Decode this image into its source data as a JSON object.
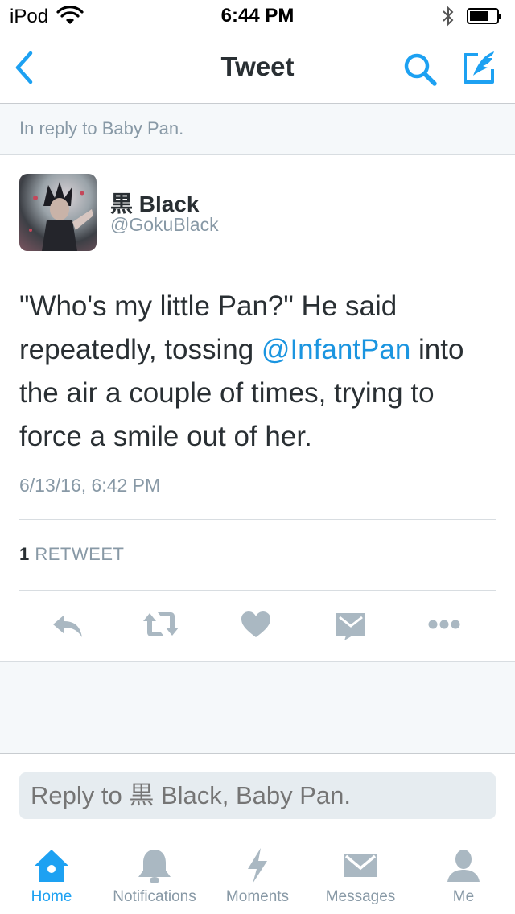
{
  "status_bar": {
    "carrier": "iPod",
    "time": "6:44 PM"
  },
  "nav": {
    "title": "Tweet",
    "back_icon": "chevron-left-icon",
    "search_icon": "search-icon",
    "compose_icon": "compose-icon"
  },
  "reply_context": "In reply to Baby Pan.",
  "tweet": {
    "author_name": "黒 Black",
    "author_handle": "@GokuBlack",
    "text_before": "\"Who's my little Pan?\" He said repeatedly, tossing ",
    "mention": "@InfantPan",
    "text_after": " into the air a couple of times, trying to force a smile out of her.",
    "timestamp": "6/13/16, 6:42 PM",
    "retweet_count": "1",
    "retweet_label": "RETWEET"
  },
  "actions": [
    "reply-icon",
    "retweet-icon",
    "heart-icon",
    "direct-message-icon",
    "more-icon"
  ],
  "reply_box": {
    "placeholder": "Reply to 黒 Black, Baby Pan."
  },
  "tabs": [
    {
      "label": "Home",
      "icon": "home-icon",
      "active": true
    },
    {
      "label": "Notifications",
      "icon": "bell-icon",
      "active": false
    },
    {
      "label": "Moments",
      "icon": "lightning-icon",
      "active": false
    },
    {
      "label": "Messages",
      "icon": "envelope-icon",
      "active": false
    },
    {
      "label": "Me",
      "icon": "person-icon",
      "active": false
    }
  ],
  "colors": {
    "accent": "#1da1f2",
    "mention": "#1b95e0",
    "secondary_text": "#8899a6",
    "action_icon": "#aab8c2"
  }
}
